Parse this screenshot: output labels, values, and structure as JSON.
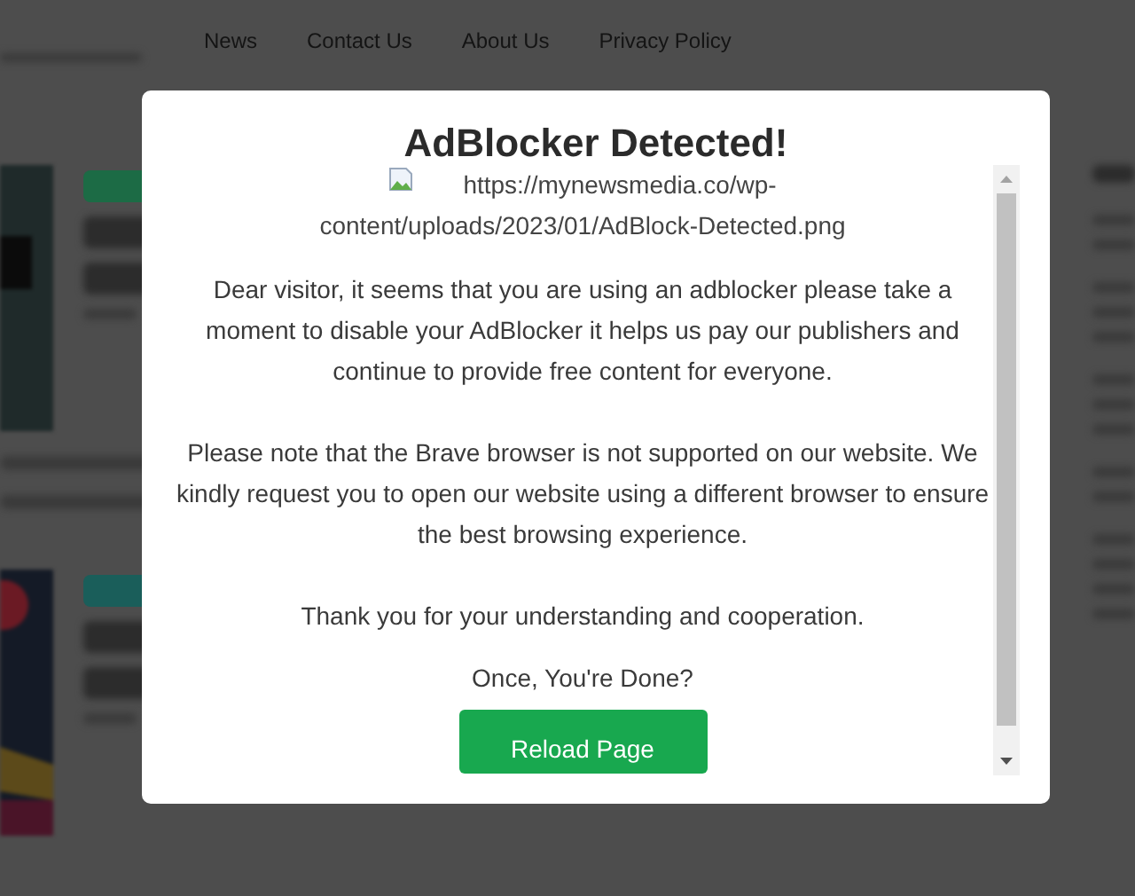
{
  "background": {
    "nav": [
      "News",
      "Contact Us",
      "About Us",
      "Privacy Policy"
    ]
  },
  "modal": {
    "title": "AdBlocker Detected!",
    "image_alt": "https://mynewsmedia.co/wp-content/uploads/2023/01/AdBlock-Detected.png",
    "paragraphs": [
      "Dear visitor, it seems that you are using an adblocker please take a moment to disable your AdBlocker it helps us pay our publishers and continue to provide free content for everyone.",
      "Please note that the Brave browser is not supported on our website. We kindly request you to open our website using a different browser to ensure the best browsing experience.",
      "Thank you for your understanding and cooperation."
    ],
    "prompt": "Once, You're Done?",
    "button": "Reload Page"
  }
}
